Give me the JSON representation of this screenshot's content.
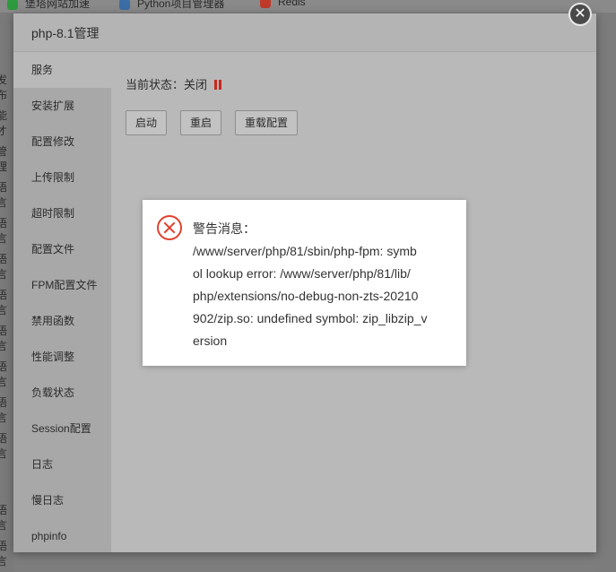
{
  "background": {
    "tabs": [
      {
        "label": "堡塔网站加速",
        "icon": "bolt-icon",
        "color": "#2e9a3e"
      },
      {
        "label": "Python项目管理器",
        "icon": "python-icon",
        "color": "#3a6ea5"
      },
      {
        "label": "Redis",
        "icon": "redis-icon",
        "color": "#c0392b"
      }
    ],
    "left_fragments": [
      "发布",
      "能才",
      "管理",
      "语言",
      "语言",
      "语言",
      "语言",
      "语言",
      "语言",
      "语言",
      "语言",
      "语言",
      "语言"
    ]
  },
  "modal": {
    "title": "php-8.1管理",
    "close_symbol": "✕",
    "sidebar": [
      "服务",
      "安装扩展",
      "配置修改",
      "上传限制",
      "超时限制",
      "配置文件",
      "FPM配置文件",
      "禁用函数",
      "性能调整",
      "负载状态",
      "Session配置",
      "日志",
      "慢日志",
      "phpinfo"
    ],
    "status_label": "当前状态：",
    "status_value": "关闭",
    "status_color": "#c8281e",
    "buttons": {
      "start": "启动",
      "restart": "重启",
      "reload": "重载配置"
    }
  },
  "alert": {
    "title": "警告消息：",
    "icon": "error-circle-icon",
    "lines": [
      "/www/server/php/81/sbin/php-fpm: symb",
      "ol lookup error: /www/server/php/81/lib/",
      "php/extensions/no-debug-non-zts-20210",
      "902/zip.so: undefined symbol: zip_libzip_v",
      "ersion"
    ]
  }
}
